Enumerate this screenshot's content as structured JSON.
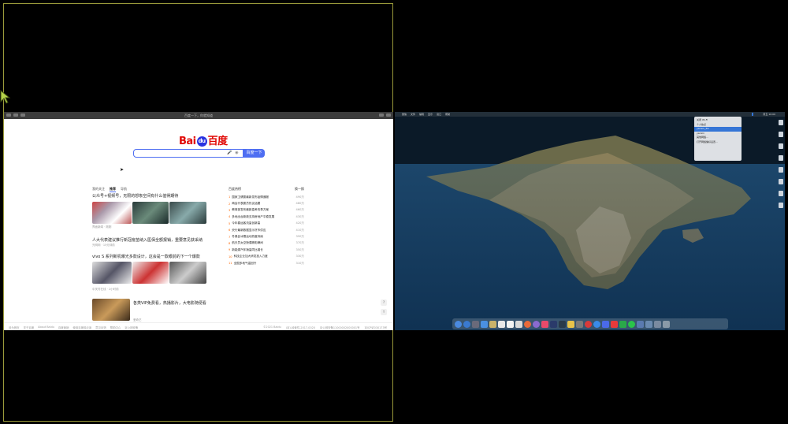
{
  "browser": {
    "title": "百度一下，你就知道",
    "logo_part1": "Bai",
    "logo_paw": "du",
    "logo_part2": "百度",
    "search_placeholder": "",
    "search_button": "百度一下",
    "feed_tabs": [
      "我的关注",
      "推荐",
      "导航"
    ],
    "news": [
      {
        "title": "公众号+视频号，无限的想象空间有什么值得期待",
        "meta": "界面新闻 · 刚刚"
      },
      {
        "title": "人大代表建议推行新冠疫苗纳入医保全额报销，重要意见获采纳",
        "meta": "光明网 · 15分钟前"
      },
      {
        "title": "vivo S 系列新机曝光多款设计，这会是一款眼前的下一个爆款",
        "meta": "中关村在线 · 2小时前"
      },
      {
        "title": "各类VIP免费看，热播影片，大电影随便看",
        "meta": "爱奇艺"
      }
    ],
    "hot_header": "百度热榜",
    "hot_refresh": "换一换",
    "hot_list": [
      {
        "rank": "1",
        "text": "国家卫健委最新发布疫情通报",
        "count": "490万"
      },
      {
        "rank": "2",
        "text": "两会代表委员热议话题",
        "count": "480万"
      },
      {
        "rank": "3",
        "text": "教育部发布最新高考改革方案",
        "count": "460万"
      },
      {
        "rank": "4",
        "text": "多地出台新政支持房地产平稳发展",
        "count": "430万"
      },
      {
        "rank": "5",
        "text": "今年春运客流量创新高",
        "count": "420万"
      },
      {
        "rank": "6",
        "text": "央行最新数据显示货币供应",
        "count": "410万"
      },
      {
        "rank": "7",
        "text": "冬奥会冰雪运动热度持续",
        "count": "390万"
      },
      {
        "rank": "8",
        "text": "航天员太空授课精彩瞬间",
        "count": "370万"
      },
      {
        "rank": "9",
        "text": "新能源汽车销量同比增长",
        "count": "350万"
      },
      {
        "rank": "10",
        "text": "科技企业加大研发投入力度",
        "count": "330万"
      },
      {
        "rank": "11",
        "text": "全国多地气温回升",
        "count": "310万"
      }
    ],
    "footer_left": [
      "设为首页",
      "关于百度",
      "About Baidu",
      "百度营销",
      "使用百度前必读",
      "意见反馈",
      "帮助中心",
      "京公网安备"
    ],
    "footer_right": [
      "©2021 Baidu",
      "(京)-经营性-2017-0020",
      "京公网安备11000002000001号",
      "京ICP证030173号"
    ]
  },
  "desktop": {
    "menubar_left": [
      "",
      "微信",
      "文件",
      "编辑",
      "显示",
      "窗口",
      "帮助"
    ],
    "menubar_right": [
      "",
      "",
      "",
      "",
      "",
      "周五 10:00",
      "",
      ""
    ],
    "dropdown_items": [
      "关闭 Wi-Fi",
      "个人热点",
      "yanxin_5G",
      "yanxin",
      "其他网络...",
      "打开网络偏好设置..."
    ]
  }
}
